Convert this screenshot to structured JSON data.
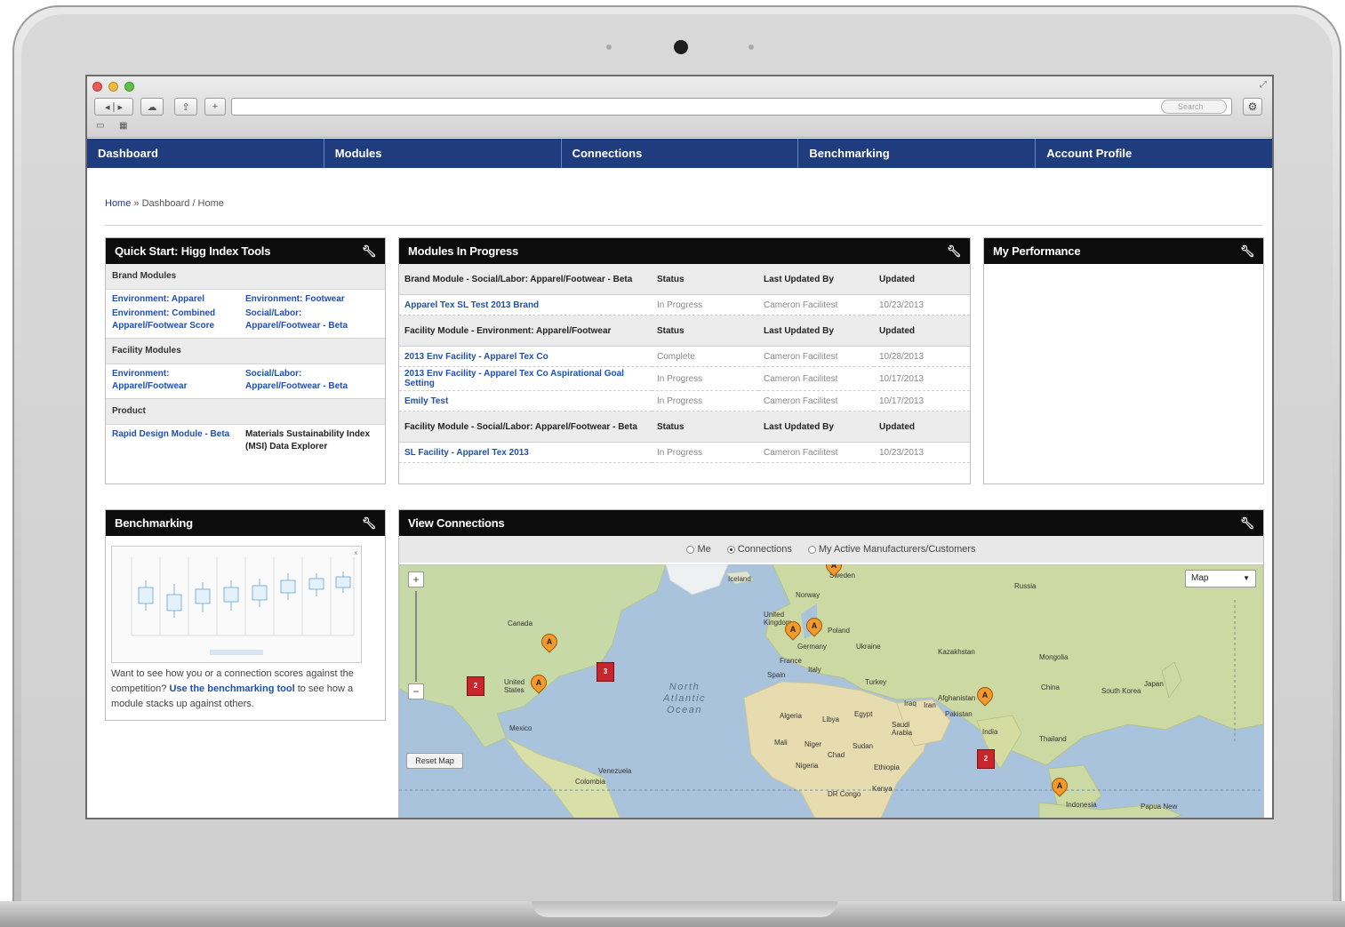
{
  "nav": {
    "items": [
      "Dashboard",
      "Modules",
      "Connections",
      "Benchmarking",
      "Account Profile"
    ]
  },
  "browser": {
    "search_placeholder": "Search"
  },
  "breadcrumb": {
    "home": "Home",
    "trail": " » Dashboard / Home"
  },
  "quick_start": {
    "title": "Quick Start: Higg Index Tools",
    "brand_heading": "Brand Modules",
    "brand_links": {
      "left": [
        "Environment: Apparel",
        "Environment: Combined Apparel/Footwear Score"
      ],
      "right": [
        "Environment: Footwear",
        "Social/Labor: Apparel/Footwear - Beta"
      ]
    },
    "facility_heading": "Facility Modules",
    "facility_links": {
      "left": [
        "Environment: Apparel/Footwear"
      ],
      "right": [
        "Social/Labor: Apparel/Footwear - Beta"
      ]
    },
    "product_heading": "Product",
    "product_left": "Rapid Design Module - Beta",
    "product_right": "Materials Sustainability Index (MSI) Data Explorer"
  },
  "modules_in_progress": {
    "title": "Modules In Progress",
    "groups": [
      {
        "heading": "Brand Module - Social/Labor: Apparel/Footwear - Beta",
        "status_h": "Status",
        "by_h": "Last Updated By",
        "updated_h": "Updated",
        "rows": [
          {
            "name": "Apparel Tex SL Test 2013 Brand",
            "status": "In Progress",
            "by": "Cameron Facilitest",
            "updated": "10/23/2013"
          }
        ]
      },
      {
        "heading": "Facility Module - Environment: Apparel/Footwear",
        "status_h": "Status",
        "by_h": "Last Updated By",
        "updated_h": "Updated",
        "rows": [
          {
            "name": "2013 Env Facility - Apparel Tex Co",
            "status": "Complete",
            "by": "Cameron Facilitest",
            "updated": "10/28/2013"
          },
          {
            "name": "2013 Env Facility - Apparel Tex Co Aspirational Goal Setting",
            "status": "In Progress",
            "by": "Cameron Facilitest",
            "updated": "10/17/2013"
          },
          {
            "name": "Emily Test",
            "status": "In Progress",
            "by": "Cameron Facilitest",
            "updated": "10/17/2013"
          }
        ]
      },
      {
        "heading": "Facility Module - Social/Labor: Apparel/Footwear - Beta",
        "status_h": "Status",
        "by_h": "Last Updated By",
        "updated_h": "Updated",
        "rows": [
          {
            "name": "SL Facility - Apparel Tex 2013",
            "status": "In Progress",
            "by": "Cameron Facilitest",
            "updated": "10/23/2013"
          }
        ]
      }
    ]
  },
  "my_performance": {
    "title": "My Performance"
  },
  "benchmarking": {
    "title": "Benchmarking",
    "text_before": "Want to see how you or a connection scores against the competition? ",
    "link": "Use the benchmarking tool",
    "text_after": " to see how a module stacks up against others."
  },
  "view_connections": {
    "title": "View Connections",
    "radios": [
      {
        "label": "Me",
        "selected": false
      },
      {
        "label": "Connections",
        "selected": true
      },
      {
        "label": "My Active Manufacturers/Customers",
        "selected": false
      }
    ],
    "map_type": "Map",
    "reset_label": "Reset Map",
    "zoom_in": "+",
    "zoom_out": "−",
    "ocean_label": "North Atlantic Ocean",
    "places": [
      "Iceland",
      "Norway",
      "Sweden",
      "United Kingdom",
      "Poland",
      "Germany",
      "Ukraine",
      "France",
      "Italy",
      "Spain",
      "Turkey",
      "Kazakhstan",
      "Russia",
      "Mongolia",
      "China",
      "South Korea",
      "Japan",
      "Afghanistan",
      "Iran",
      "Iraq",
      "Pakistan",
      "India",
      "Thailand",
      "Indonesia",
      "Papua New",
      "Canada",
      "United States",
      "Mexico",
      "Venezuela",
      "Colombia",
      "Algeria",
      "Libya",
      "Egypt",
      "Saudi Arabia",
      "Mali",
      "Niger",
      "Chad",
      "Sudan",
      "Ethiopia",
      "Nigeria",
      "Kenya",
      "DR Congo"
    ],
    "pins_orange": [
      "A",
      "A",
      "A",
      "A",
      "A",
      "A",
      "A",
      "A"
    ],
    "pins_red": [
      "2",
      "3",
      "2"
    ]
  }
}
